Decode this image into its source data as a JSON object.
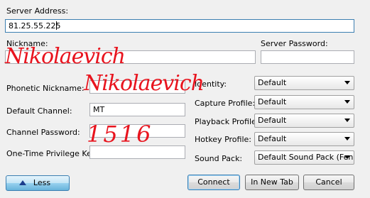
{
  "server": {
    "address_label": "Server Address:",
    "address_value": "81.25.55.225",
    "nickname_label": "Nickname:",
    "nickname_value": "",
    "server_password_label": "Server Password:",
    "server_password_value": ""
  },
  "left": {
    "phonetic_label": "Phonetic Nickname:",
    "phonetic_value": "",
    "default_channel_label": "Default Channel:",
    "default_channel_value": "MT",
    "channel_password_label": "Channel Password:",
    "channel_password_value": "",
    "privilege_key_label": "One-Time Privilege Key:",
    "privilege_key_value": ""
  },
  "right": {
    "identity_label": "Identity:",
    "identity_value": "Default",
    "capture_label": "Capture Profile:",
    "capture_value": "Default",
    "playback_label": "Playback Profile:",
    "playback_value": "Default",
    "hotkey_label": "Hotkey Profile:",
    "hotkey_value": "Default",
    "soundpack_label": "Sound Pack:",
    "soundpack_value": "Default Sound Pack (Fen"
  },
  "buttons": {
    "less": "Less",
    "connect": "Connect",
    "new_tab": "In New Tab",
    "cancel": "Cancel"
  },
  "handwriting": {
    "nick_top": "Nikolaevich",
    "nick_mid": "Nikolaevich",
    "password": "1516"
  },
  "colors": {
    "ink": "#e8141e",
    "focus_border": "#3c7fb1",
    "window_bg": "#f0f0f0"
  }
}
